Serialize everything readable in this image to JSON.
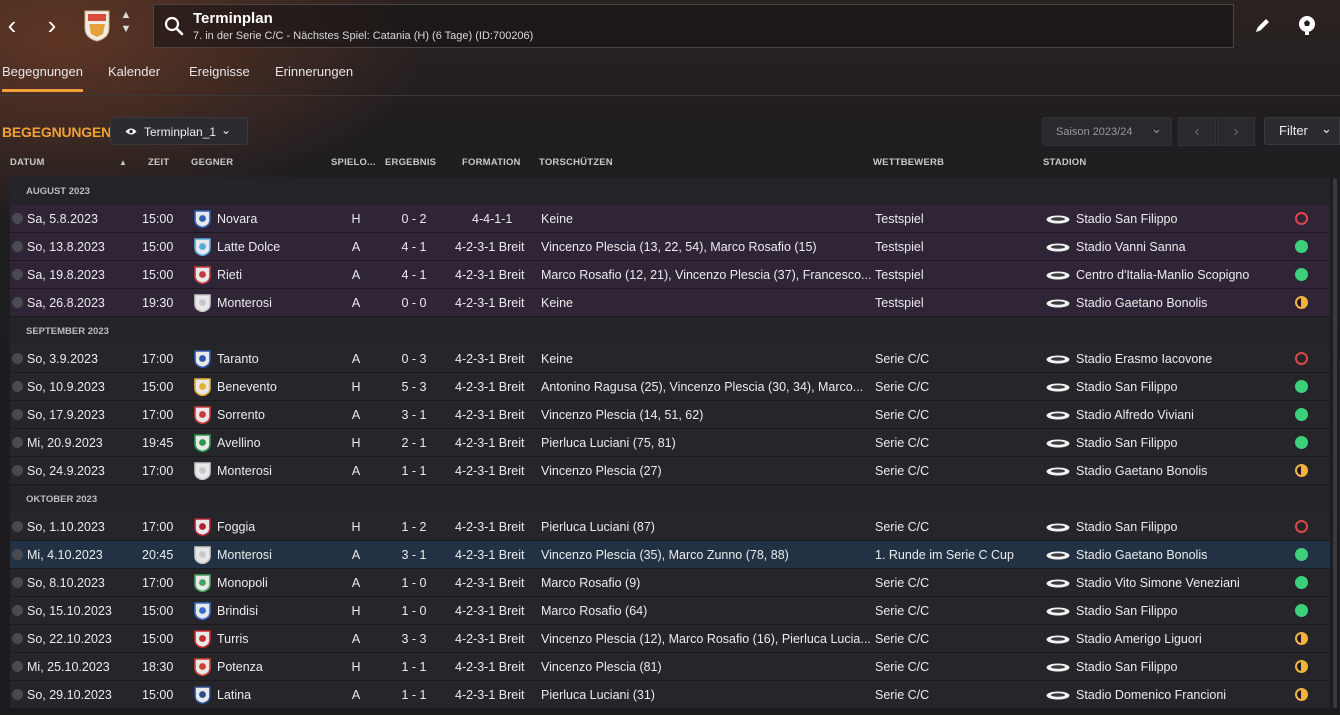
{
  "header": {
    "title": "Terminplan",
    "subtitle": "7. in der Serie C/C - Nächstes Spiel: Catania (H) (6 Tage) (ID:700206)",
    "back_glyph": "‹",
    "forward_glyph": "›"
  },
  "tabs": [
    {
      "label": "Begegnungen"
    },
    {
      "label": "Kalender"
    },
    {
      "label": "Ereignisse"
    },
    {
      "label": "Erinnerungen"
    }
  ],
  "section": {
    "title": "BEGEGNUNGEN",
    "view_label": "Terminplan_1",
    "season_label": "Saison 2023/24",
    "filter_label": "Filter"
  },
  "columns": {
    "date": "DATUM",
    "time": "ZEIT",
    "opponent": "GEGNER",
    "venue": "SPIELO...",
    "result": "ERGEBNIS",
    "formation": "FORMATION",
    "scorers": "TORSCHÜTZEN",
    "competition": "WETTBEWERB",
    "stadium": "STADION"
  },
  "groups": [
    {
      "label": "AUGUST 2023"
    },
    {
      "label": "SEPTEMBER 2023"
    },
    {
      "label": "OKTOBER 2023"
    }
  ],
  "matches": [
    {
      "date": "Sa, 5.8.2023",
      "time": "15:00",
      "opponent": "Novara",
      "venue": "H",
      "result": "0 - 2",
      "formation": "4-4-1-1",
      "scorers": "Keine",
      "competition": "Testspiel",
      "stadium": "Stadio San Filippo",
      "outcome": "loss"
    },
    {
      "date": "So, 13.8.2023",
      "time": "15:00",
      "opponent": "Latte Dolce",
      "venue": "A",
      "result": "4 - 1",
      "formation": "4-2-3-1 Breit",
      "scorers": "Vincenzo Plescia (13, 22, 54), Marco Rosafio (15)",
      "competition": "Testspiel",
      "stadium": "Stadio Vanni Sanna",
      "outcome": "win"
    },
    {
      "date": "Sa, 19.8.2023",
      "time": "15:00",
      "opponent": "Rieti",
      "venue": "A",
      "result": "4 - 1",
      "formation": "4-2-3-1 Breit",
      "scorers": "Marco Rosafio (12, 21), Vincenzo Plescia (37), Francesco...",
      "competition": "Testspiel",
      "stadium": "Centro d'Italia-Manlio Scopigno",
      "outcome": "win"
    },
    {
      "date": "Sa, 26.8.2023",
      "time": "19:30",
      "opponent": "Monterosi",
      "venue": "A",
      "result": "0 - 0",
      "formation": "4-2-3-1 Breit",
      "scorers": "Keine",
      "competition": "Testspiel",
      "stadium": "Stadio Gaetano Bonolis",
      "outcome": "draw"
    },
    {
      "date": "So, 3.9.2023",
      "time": "17:00",
      "opponent": "Taranto",
      "venue": "A",
      "result": "0 - 3",
      "formation": "4-2-3-1 Breit",
      "scorers": "Keine",
      "competition": "Serie C/C",
      "stadium": "Stadio Erasmo Iacovone",
      "outcome": "loss"
    },
    {
      "date": "So, 10.9.2023",
      "time": "15:00",
      "opponent": "Benevento",
      "venue": "H",
      "result": "5 - 3",
      "formation": "4-2-3-1 Breit",
      "scorers": "Antonino Ragusa (25), Vincenzo Plescia (30, 34), Marco...",
      "competition": "Serie C/C",
      "stadium": "Stadio San Filippo",
      "outcome": "win"
    },
    {
      "date": "So, 17.9.2023",
      "time": "17:00",
      "opponent": "Sorrento",
      "venue": "A",
      "result": "3 - 1",
      "formation": "4-2-3-1 Breit",
      "scorers": "Vincenzo Plescia (14, 51, 62)",
      "competition": "Serie C/C",
      "stadium": "Stadio Alfredo Viviani",
      "outcome": "win"
    },
    {
      "date": "Mi, 20.9.2023",
      "time": "19:45",
      "opponent": "Avellino",
      "venue": "H",
      "result": "2 - 1",
      "formation": "4-2-3-1 Breit",
      "scorers": "Pierluca Luciani (75, 81)",
      "competition": "Serie C/C",
      "stadium": "Stadio San Filippo",
      "outcome": "win"
    },
    {
      "date": "So, 24.9.2023",
      "time": "17:00",
      "opponent": "Monterosi",
      "venue": "A",
      "result": "1 - 1",
      "formation": "4-2-3-1 Breit",
      "scorers": "Vincenzo Plescia (27)",
      "competition": "Serie C/C",
      "stadium": "Stadio Gaetano Bonolis",
      "outcome": "draw"
    },
    {
      "date": "So, 1.10.2023",
      "time": "17:00",
      "opponent": "Foggia",
      "venue": "H",
      "result": "1 - 2",
      "formation": "4-2-3-1 Breit",
      "scorers": "Pierluca Luciani (87)",
      "competition": "Serie C/C",
      "stadium": "Stadio San Filippo",
      "outcome": "loss"
    },
    {
      "date": "Mi, 4.10.2023",
      "time": "20:45",
      "opponent": "Monterosi",
      "venue": "A",
      "result": "3 - 1",
      "formation": "4-2-3-1 Breit",
      "scorers": "Vincenzo Plescia (35), Marco Zunno (78, 88)",
      "competition": "1. Runde im Serie C Cup",
      "stadium": "Stadio Gaetano Bonolis",
      "outcome": "win"
    },
    {
      "date": "So, 8.10.2023",
      "time": "17:00",
      "opponent": "Monopoli",
      "venue": "A",
      "result": "1 - 0",
      "formation": "4-2-3-1 Breit",
      "scorers": "Marco Rosafio (9)",
      "competition": "Serie C/C",
      "stadium": "Stadio Vito Simone Veneziani",
      "outcome": "win"
    },
    {
      "date": "So, 15.10.2023",
      "time": "15:00",
      "opponent": "Brindisi",
      "venue": "H",
      "result": "1 - 0",
      "formation": "4-2-3-1 Breit",
      "scorers": "Marco Rosafio (64)",
      "competition": "Serie C/C",
      "stadium": "Stadio San Filippo",
      "outcome": "win"
    },
    {
      "date": "So, 22.10.2023",
      "time": "15:00",
      "opponent": "Turris",
      "venue": "A",
      "result": "3 - 3",
      "formation": "4-2-3-1 Breit",
      "scorers": "Vincenzo Plescia (12), Marco Rosafio (16), Pierluca Lucia...",
      "competition": "Serie C/C",
      "stadium": "Stadio Amerigo Liguori",
      "outcome": "draw"
    },
    {
      "date": "Mi, 25.10.2023",
      "time": "18:30",
      "opponent": "Potenza",
      "venue": "H",
      "result": "1 - 1",
      "formation": "4-2-3-1 Breit",
      "scorers": "Vincenzo Plescia (81)",
      "competition": "Serie C/C",
      "stadium": "Stadio San Filippo",
      "outcome": "draw"
    },
    {
      "date": "So, 29.10.2023",
      "time": "15:00",
      "opponent": "Latina",
      "venue": "A",
      "result": "1 - 1",
      "formation": "4-2-3-1 Breit",
      "scorers": "Pierluca Luciani (31)",
      "competition": "Serie C/C",
      "stadium": "Stadio Domenico Francioni",
      "outcome": "draw"
    }
  ],
  "colors": {
    "accent": "#f0a036",
    "win": "#3ecf7a",
    "draw": "#f0b43c",
    "loss": "#d94848",
    "friendly_row": "#2f2537",
    "selected_row": "#223244"
  }
}
